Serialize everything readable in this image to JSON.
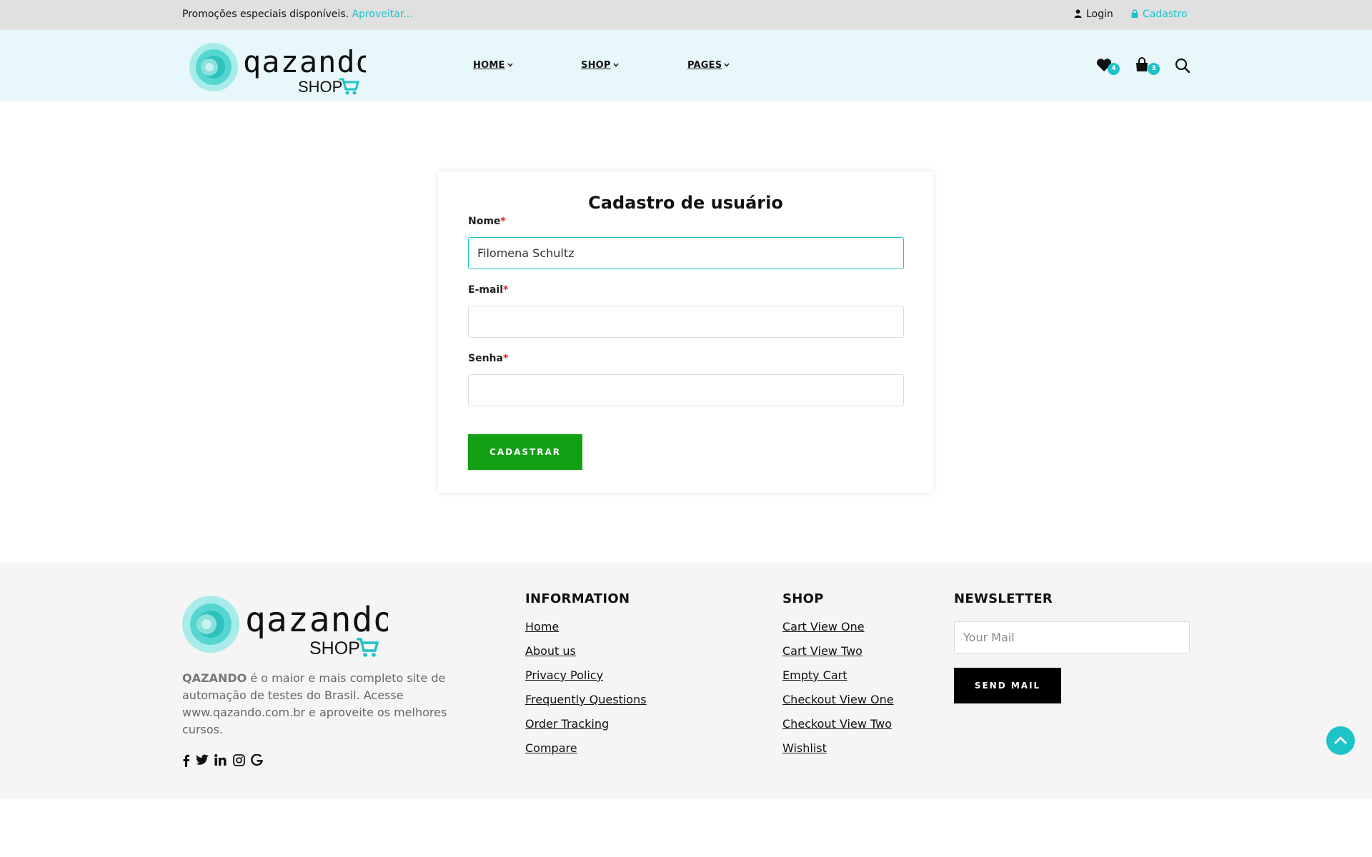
{
  "topbar": {
    "promo_text": "Promoções especiais disponíveis.",
    "promo_link": "Aproveitar...",
    "login_label": "Login",
    "signup_label": "Cadastro"
  },
  "header": {
    "logo_name": "qazando",
    "logo_sub": "SHOP",
    "nav": [
      {
        "label": "HOME"
      },
      {
        "label": "SHOP"
      },
      {
        "label": "PAGES"
      }
    ],
    "wishlist_count": "4",
    "cart_count": "3"
  },
  "form": {
    "title": "Cadastro de usuário",
    "name_label": "Nome",
    "name_value": "Filomena Schultz",
    "email_label": "E-mail",
    "email_value": "",
    "password_label": "Senha",
    "password_value": "",
    "required_mark": "*",
    "submit_label": "CADASTRAR"
  },
  "footer": {
    "logo_name": "qazando",
    "logo_sub": "SHOP",
    "brand": "QAZANDO",
    "description": " é o maior e mais completo site de automação de testes do Brasil. Acesse www.qazando.com.br e aproveite os melhores cursos.",
    "information": {
      "title": "INFORMATION",
      "links": [
        "Home",
        "About us",
        "Privacy Policy",
        "Frequently Questions",
        "Order Tracking",
        "Compare"
      ]
    },
    "shop": {
      "title": "SHOP",
      "links": [
        "Cart View One",
        "Cart View Two",
        "Empty Cart",
        "Checkout View One",
        "Checkout View Two",
        "Wishlist"
      ]
    },
    "newsletter": {
      "title": "NEWSLETTER",
      "placeholder": "Your Mail",
      "button_label": "SEND MAIL"
    },
    "social_icons": [
      "facebook-icon",
      "twitter-icon",
      "linkedin-icon",
      "instagram-icon",
      "google-icon"
    ]
  },
  "colors": {
    "accent": "#1cc3c9",
    "submit_green": "#12a014",
    "topbar_bg": "#e0e0e0",
    "header_bg": "#e8f7fa",
    "footer_bg": "#f5f5f5"
  }
}
